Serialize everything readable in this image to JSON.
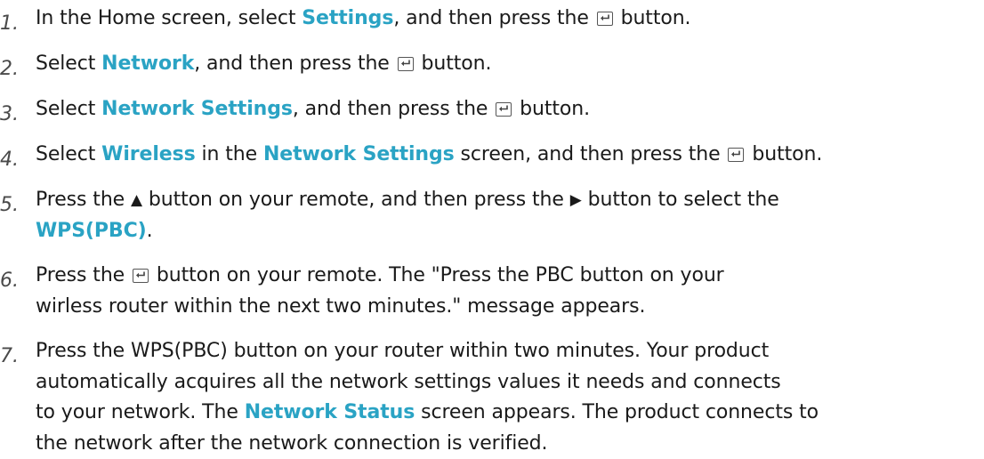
{
  "steps": [
    {
      "number": "1.",
      "parts": [
        {
          "t": "text",
          "v": "In the Home screen, select "
        },
        {
          "t": "hl",
          "v": "Settings"
        },
        {
          "t": "text",
          "v": ", and then press the "
        },
        {
          "t": "icon",
          "v": "enter-icon"
        },
        {
          "t": "text",
          "v": " button."
        }
      ]
    },
    {
      "number": "2.",
      "parts": [
        {
          "t": "text",
          "v": "Select "
        },
        {
          "t": "hl",
          "v": "Network"
        },
        {
          "t": "text",
          "v": ", and then press the "
        },
        {
          "t": "icon",
          "v": "enter-icon"
        },
        {
          "t": "text",
          "v": " button."
        }
      ]
    },
    {
      "number": "3.",
      "parts": [
        {
          "t": "text",
          "v": "Select "
        },
        {
          "t": "hl",
          "v": "Network Settings"
        },
        {
          "t": "text",
          "v": ", and then press the "
        },
        {
          "t": "icon",
          "v": "enter-icon"
        },
        {
          "t": "text",
          "v": " button."
        }
      ]
    },
    {
      "number": "4.",
      "parts": [
        {
          "t": "text",
          "v": "Select "
        },
        {
          "t": "hl",
          "v": "Wireless"
        },
        {
          "t": "text",
          "v": " in the "
        },
        {
          "t": "hl",
          "v": "Network Settings"
        },
        {
          "t": "text",
          "v": " screen, and then press the "
        },
        {
          "t": "icon",
          "v": "enter-icon"
        },
        {
          "t": "text",
          "v": " button."
        }
      ]
    },
    {
      "number": "5.",
      "parts": [
        {
          "t": "text",
          "v": "Press the "
        },
        {
          "t": "glyph",
          "v": "▲",
          "name": "up-arrow-icon"
        },
        {
          "t": "text",
          "v": " button on your remote, and then press the "
        },
        {
          "t": "glyph",
          "v": "▶",
          "name": "right-arrow-icon"
        },
        {
          "t": "text",
          "v": " button to select the "
        },
        {
          "t": "br"
        },
        {
          "t": "hl",
          "v": "WPS(PBC)"
        },
        {
          "t": "text",
          "v": "."
        }
      ]
    },
    {
      "number": "6.",
      "parts": [
        {
          "t": "text",
          "v": "Press the "
        },
        {
          "t": "icon",
          "v": "enter-icon"
        },
        {
          "t": "text",
          "v": " button on your remote. The \"Press the PBC button on your"
        },
        {
          "t": "br"
        },
        {
          "t": "text",
          "v": "wirless router within the next two minutes.\" message appears."
        }
      ]
    },
    {
      "number": "7.",
      "parts": [
        {
          "t": "text",
          "v": "Press the WPS(PBC) button on your router within two minutes. Your product"
        },
        {
          "t": "br"
        },
        {
          "t": "text",
          "v": "automatically acquires all the network settings values it needs and connects"
        },
        {
          "t": "br"
        },
        {
          "t": "text",
          "v": "to your network. The "
        },
        {
          "t": "hl",
          "v": "Network Status"
        },
        {
          "t": "text",
          "v": " screen appears. The product connects to"
        },
        {
          "t": "br"
        },
        {
          "t": "text",
          "v": "the network after the network connection is verified."
        }
      ]
    }
  ],
  "colors": {
    "highlight": "#2aa3c4",
    "text": "#1a1a1a",
    "number": "#4a4a4a"
  }
}
